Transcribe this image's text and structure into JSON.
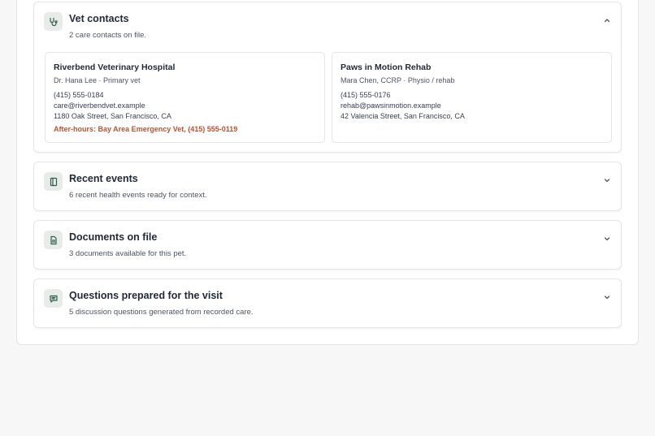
{
  "sections": {
    "vet_contacts": {
      "title": "Vet contacts",
      "subtitle": "2 care contacts on file.",
      "icon": "stethoscope-icon",
      "expanded": true,
      "contacts": [
        {
          "name": "Riverbend Veterinary Hospital",
          "role": "Dr. Hana Lee · Primary vet",
          "phone": "(415) 555-0184",
          "email": "care@riverbendvet.example",
          "address": "1180 Oak Street, San Francisco, CA",
          "after_hours": "After-hours: Bay Area Emergency Vet, (415) 555-0119"
        },
        {
          "name": "Paws in Motion Rehab",
          "role": "Mara Chen, CCRP · Physio / rehab",
          "phone": "(415) 555-0176",
          "email": "rehab@pawsinmotion.example",
          "address": "42 Valencia Street, San Francisco, CA"
        }
      ]
    },
    "recent_events": {
      "title": "Recent events",
      "subtitle": "6 recent health events ready for context.",
      "icon": "notebook-icon",
      "expanded": false
    },
    "documents": {
      "title": "Documents on file",
      "subtitle": "3 documents available for this pet.",
      "icon": "document-icon",
      "expanded": false
    },
    "questions": {
      "title": "Questions prepared for the visit",
      "subtitle": "5 discussion questions generated from recorded care.",
      "icon": "message-icon",
      "expanded": false
    }
  },
  "colors": {
    "accent_icon": "#2f5d4a",
    "after_hours": "#c2502f",
    "icon_bg": "#e8ece9"
  }
}
